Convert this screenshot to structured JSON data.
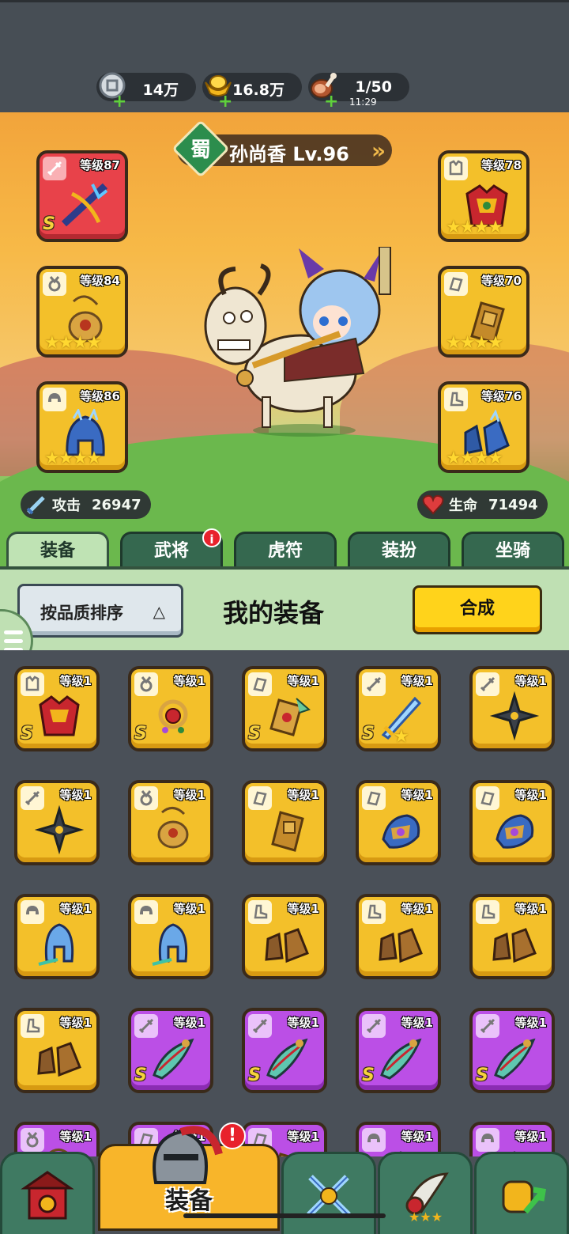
{
  "resources": [
    {
      "icon": "silver-coin-icon",
      "value": "14万",
      "sub": ""
    },
    {
      "icon": "gold-ingot-icon",
      "value": "16.8万",
      "sub": ""
    },
    {
      "icon": "meat-stamina-icon",
      "value": "1/50",
      "sub": "11:29"
    }
  ],
  "hero": {
    "kingdom": "蜀",
    "name": "孙尚香 Lv.96"
  },
  "equipped_left": [
    {
      "slot_icon": "sword-icon",
      "level": "等级87",
      "rank": "S",
      "stars": 0,
      "quality": "red",
      "item_icon": "crossbow-icon"
    },
    {
      "slot_icon": "medal-icon",
      "level": "等级84",
      "rank": "",
      "stars": 4,
      "quality": "gold",
      "item_icon": "amulet-icon"
    },
    {
      "slot_icon": "helmet-icon",
      "level": "等级86",
      "rank": "",
      "stars": 4,
      "quality": "gold",
      "item_icon": "ice-helmet-icon"
    }
  ],
  "equipped_right": [
    {
      "slot_icon": "armor-icon",
      "level": "等级78",
      "rank": "",
      "stars": 4,
      "quality": "gold",
      "item_icon": "red-armor-icon"
    },
    {
      "slot_icon": "scroll-icon",
      "level": "等级70",
      "rank": "",
      "stars": 4,
      "quality": "gold",
      "item_icon": "bracer-icon"
    },
    {
      "slot_icon": "boot-icon",
      "level": "等级76",
      "rank": "",
      "stars": 4,
      "quality": "gold",
      "item_icon": "ice-boots-icon"
    }
  ],
  "stats": {
    "attack_label": "攻击",
    "attack_value": "26947",
    "hp_label": "生命",
    "hp_value": "71494"
  },
  "tabs": [
    {
      "label": "装备",
      "active": true,
      "badge": ""
    },
    {
      "label": "武将",
      "active": false,
      "badge": "i"
    },
    {
      "label": "虎符",
      "active": false,
      "badge": ""
    },
    {
      "label": "装扮",
      "active": false,
      "badge": ""
    },
    {
      "label": "坐骑",
      "active": false,
      "badge": ""
    }
  ],
  "panel": {
    "sort_label": "按品质排序",
    "sort_arrow": "△",
    "title": "我的装备",
    "merge_label": "合成"
  },
  "inventory": [
    {
      "slot_icon": "armor-icon",
      "level": "等级1",
      "rank": "S",
      "stars": 0,
      "quality": "gold",
      "item_icon": "red-armor-icon"
    },
    {
      "slot_icon": "medal-icon",
      "level": "等级1",
      "rank": "S",
      "stars": 0,
      "quality": "gold",
      "item_icon": "ruby-necklace-icon"
    },
    {
      "slot_icon": "scroll-icon",
      "level": "等级1",
      "rank": "S",
      "stars": 0,
      "quality": "gold",
      "item_icon": "dragon-bracer-icon"
    },
    {
      "slot_icon": "sword-icon",
      "level": "等级1",
      "rank": "S",
      "stars": 1,
      "quality": "gold",
      "item_icon": "ice-sword-icon"
    },
    {
      "slot_icon": "sword-icon",
      "level": "等级1",
      "rank": "",
      "stars": 0,
      "quality": "gold",
      "item_icon": "shuriken-icon"
    },
    {
      "slot_icon": "sword-icon",
      "level": "等级1",
      "rank": "",
      "stars": 0,
      "quality": "gold",
      "item_icon": "shuriken-icon"
    },
    {
      "slot_icon": "medal-icon",
      "level": "等级1",
      "rank": "",
      "stars": 0,
      "quality": "gold",
      "item_icon": "amulet-icon"
    },
    {
      "slot_icon": "scroll-icon",
      "level": "等级1",
      "rank": "",
      "stars": 0,
      "quality": "gold",
      "item_icon": "bracer-icon"
    },
    {
      "slot_icon": "scroll-icon",
      "level": "等级1",
      "rank": "",
      "stars": 0,
      "quality": "gold",
      "item_icon": "gem-bracer-icon"
    },
    {
      "slot_icon": "scroll-icon",
      "level": "等级1",
      "rank": "",
      "stars": 0,
      "quality": "gold",
      "item_icon": "gem-bracer-icon"
    },
    {
      "slot_icon": "helmet-icon",
      "level": "等级1",
      "rank": "",
      "stars": 0,
      "quality": "gold",
      "item_icon": "blue-helmet-icon"
    },
    {
      "slot_icon": "helmet-icon",
      "level": "等级1",
      "rank": "",
      "stars": 0,
      "quality": "gold",
      "item_icon": "blue-helmet-icon"
    },
    {
      "slot_icon": "boot-icon",
      "level": "等级1",
      "rank": "",
      "stars": 0,
      "quality": "gold",
      "item_icon": "leather-boots-icon"
    },
    {
      "slot_icon": "boot-icon",
      "level": "等级1",
      "rank": "",
      "stars": 0,
      "quality": "gold",
      "item_icon": "leather-boots-icon"
    },
    {
      "slot_icon": "boot-icon",
      "level": "等级1",
      "rank": "",
      "stars": 0,
      "quality": "gold",
      "item_icon": "leather-boots-icon"
    },
    {
      "slot_icon": "boot-icon",
      "level": "等级1",
      "rank": "",
      "stars": 0,
      "quality": "gold",
      "item_icon": "leather-boots-icon"
    },
    {
      "slot_icon": "sword-icon",
      "level": "等级1",
      "rank": "S",
      "stars": 0,
      "quality": "purple",
      "item_icon": "curved-blade-icon"
    },
    {
      "slot_icon": "sword-icon",
      "level": "等级1",
      "rank": "S",
      "stars": 0,
      "quality": "purple",
      "item_icon": "curved-blade-icon"
    },
    {
      "slot_icon": "sword-icon",
      "level": "等级1",
      "rank": "S",
      "stars": 0,
      "quality": "purple",
      "item_icon": "curved-blade-icon"
    },
    {
      "slot_icon": "sword-icon",
      "level": "等级1",
      "rank": "S",
      "stars": 0,
      "quality": "purple",
      "item_icon": "curved-blade-icon"
    },
    {
      "slot_icon": "medal-icon",
      "level": "等级1",
      "rank": "",
      "stars": 0,
      "quality": "purple",
      "item_icon": "amulet-icon"
    },
    {
      "slot_icon": "scroll-icon",
      "level": "等级1",
      "rank": "",
      "stars": 0,
      "quality": "purple",
      "item_icon": "bracer-icon"
    },
    {
      "slot_icon": "scroll-icon",
      "level": "等级1",
      "rank": "",
      "stars": 0,
      "quality": "purple",
      "item_icon": "bracer-icon"
    },
    {
      "slot_icon": "helmet-icon",
      "level": "等级1",
      "rank": "",
      "stars": 0,
      "quality": "purple",
      "item_icon": "helmet-icon"
    },
    {
      "slot_icon": "helmet-icon",
      "level": "等级1",
      "rank": "",
      "stars": 0,
      "quality": "purple",
      "item_icon": "helmet-icon"
    }
  ],
  "bottom_nav": [
    {
      "icon": "gate-tower-icon",
      "label": "",
      "active": false
    },
    {
      "icon": "knight-helmet-icon",
      "label": "装备",
      "active": true,
      "badge": "!"
    },
    {
      "icon": "crossed-swords-icon",
      "label": "",
      "active": false
    },
    {
      "icon": "horn-icon",
      "label": "",
      "active": false
    },
    {
      "icon": "fist-upgrade-icon",
      "label": "",
      "active": false
    }
  ],
  "colors": {
    "gold": "#f3c02a",
    "purple": "#bb4fe6",
    "red": "#e8424a",
    "tab_green": "#35684f",
    "panel_green": "#bfe0b3",
    "merge_yellow": "#ffd31b"
  }
}
